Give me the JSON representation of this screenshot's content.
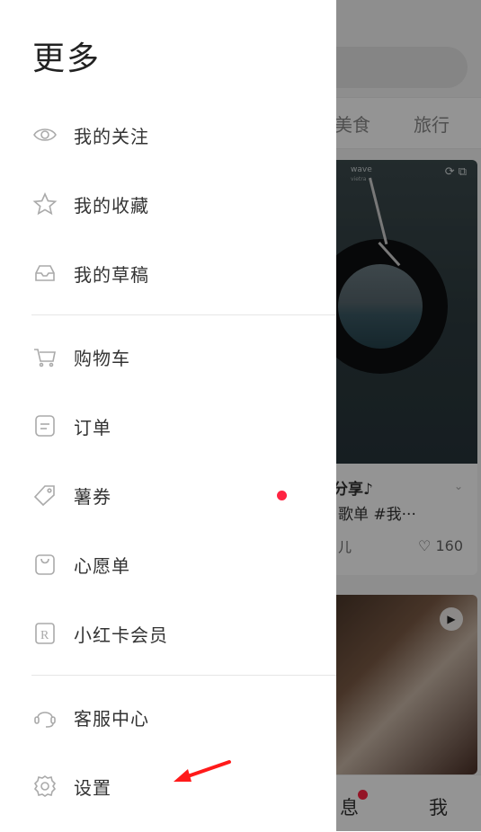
{
  "drawer": {
    "title": "更多",
    "items": [
      {
        "label": "我的关注",
        "icon": "eye-icon"
      },
      {
        "label": "我的收藏",
        "icon": "star-icon"
      },
      {
        "label": "我的草稿",
        "icon": "inbox-icon"
      },
      {
        "label": "购物车",
        "icon": "cart-icon"
      },
      {
        "label": "订单",
        "icon": "order-icon"
      },
      {
        "label": "薯券",
        "icon": "coupon-tag-icon"
      },
      {
        "label": "心愿单",
        "icon": "wishlist-bag-icon"
      },
      {
        "label": "小红卡会员",
        "icon": "r-card-icon"
      },
      {
        "label": "客服中心",
        "icon": "headset-icon"
      },
      {
        "label": "设置",
        "icon": "settings-gear-icon"
      }
    ],
    "badges": {
      "coupon_dot_color": "#ff2442"
    }
  },
  "background": {
    "tabs": [
      "美食",
      "旅行"
    ],
    "card1": {
      "brand_text": "wave",
      "brand_sub": "vietra",
      "title_line1": "分享♪",
      "title_line2": "歌单 #我···",
      "user": "儿",
      "likes": "160"
    },
    "bottom_tabs": [
      "息",
      "我"
    ]
  },
  "colors": {
    "accent_red": "#ff2442",
    "annotation_arrow": "#ff1a1a"
  }
}
